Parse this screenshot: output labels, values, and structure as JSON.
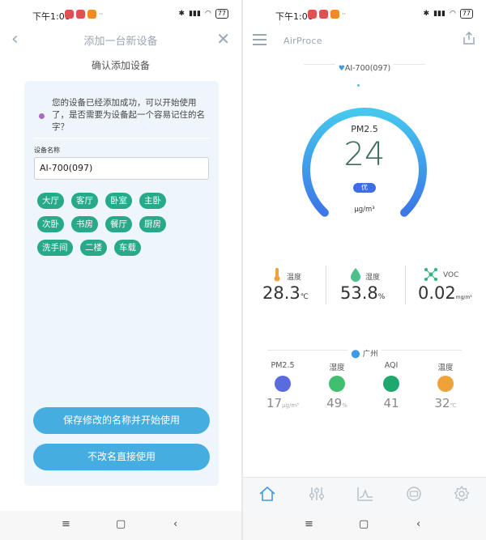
{
  "status_bar": {
    "time": "下午1:06",
    "battery": "77"
  },
  "left_screen": {
    "title": "添加一台新设备",
    "subtitle": "确认添加设备",
    "message": "您的设备已经添加成功，可以开始使用了，是否需要为设备起一个容易记住的名字？",
    "name_label": "设备名称",
    "name_value": "AI-700(097)",
    "tags": [
      "大厅",
      "客厅",
      "卧室",
      "主卧",
      "次卧",
      "书房",
      "餐厅",
      "厨房",
      "洗手间",
      "二楼",
      "车载"
    ],
    "save_button": "保存修改的名称并开始使用",
    "plain_button": "不改名直接使用"
  },
  "right_screen": {
    "brand": "AirProce",
    "device_name": "AI-700(097)",
    "gauge": {
      "label": "PM2.5",
      "value": "24",
      "level": "优",
      "unit": "μg/m³",
      "fill_fraction": 0.2
    },
    "indoor": [
      {
        "label": "温度",
        "value": "28.3",
        "unit": "℃",
        "icon": "thermometer-icon",
        "color": "#f0a23a"
      },
      {
        "label": "湿度",
        "value": "53.8",
        "unit": "%",
        "icon": "droplet-icon",
        "color": "#4cc08a"
      },
      {
        "label": "VOC",
        "value": "0.02",
        "unit": "mg/m³",
        "icon": "molecule-icon",
        "color": "#2db67c"
      }
    ],
    "city": "广州",
    "outdoor": [
      {
        "label": "PM2.5",
        "value": "17",
        "unit": "μg/m³",
        "icon": "particles-icon",
        "color": "#5a6be0"
      },
      {
        "label": "湿度",
        "value": "49",
        "unit": "%",
        "icon": "droplet-icon",
        "color": "#3fbf6f"
      },
      {
        "label": "AQI",
        "value": "41",
        "unit": "",
        "icon": "cloud-icon",
        "color": "#1fa86e"
      },
      {
        "label": "温度",
        "value": "32",
        "unit": "℃",
        "icon": "thermometer-icon",
        "color": "#f0a23a"
      }
    ]
  }
}
